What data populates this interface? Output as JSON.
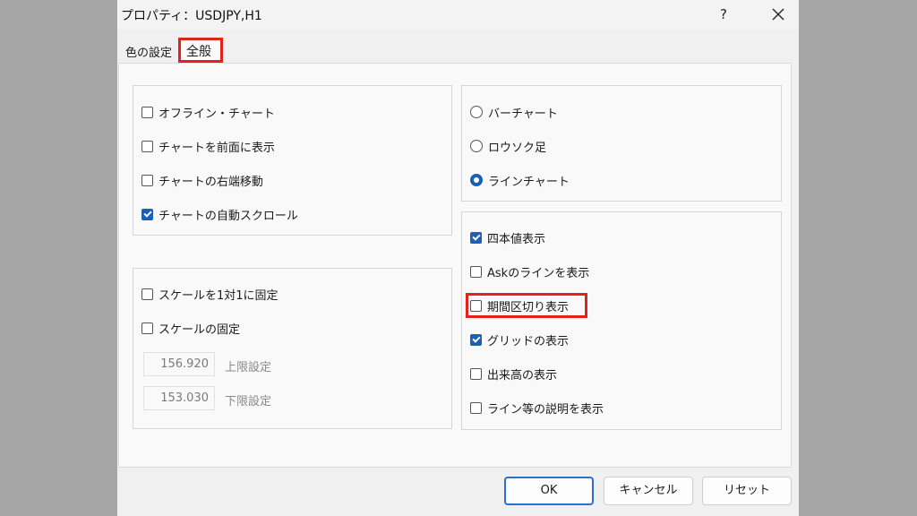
{
  "window": {
    "title": "プロパティ：USDJPY,H1",
    "help_label": "?"
  },
  "tabs": [
    {
      "label": "色の設定"
    },
    {
      "label": "全般",
      "active": true
    }
  ],
  "chart_options": [
    {
      "label": "オフライン・チャート",
      "checked": false
    },
    {
      "label": "チャートを前面に表示",
      "checked": false
    },
    {
      "label": "チャートの右端移動",
      "checked": false
    },
    {
      "label": "チャートの自動スクロール",
      "checked": true
    }
  ],
  "scale_options": [
    {
      "label": "スケールを1対1に固定",
      "checked": false
    },
    {
      "label": "スケールの固定",
      "checked": false
    }
  ],
  "scale_fields": {
    "upper_value": "156.920",
    "upper_label": "上限設定",
    "lower_value": "153.030",
    "lower_label": "下限設定"
  },
  "chart_type": [
    {
      "label": "バーチャート",
      "selected": false
    },
    {
      "label": "ロウソク足",
      "selected": false
    },
    {
      "label": "ラインチャート",
      "selected": true
    }
  ],
  "display_options": [
    {
      "label": "四本値表示",
      "checked": true
    },
    {
      "label": "Askのラインを表示",
      "checked": false
    },
    {
      "label": "期間区切り表示",
      "checked": false
    },
    {
      "label": "グリッドの表示",
      "checked": true
    },
    {
      "label": "出来高の表示",
      "checked": false
    },
    {
      "label": "ライン等の説明を表示",
      "checked": false
    }
  ],
  "buttons": {
    "ok": "OK",
    "cancel": "キャンセル",
    "reset": "リセット"
  }
}
